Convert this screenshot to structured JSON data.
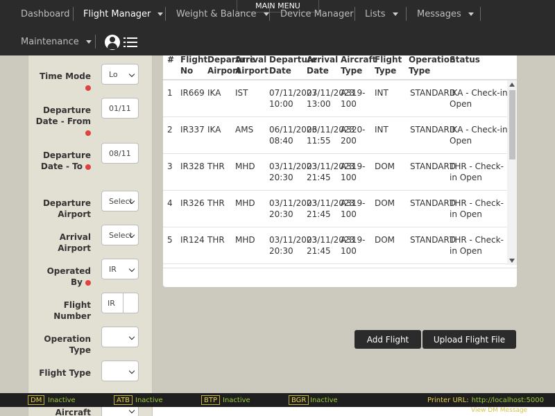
{
  "topbar": {
    "main_menu": "MAIN MENU",
    "nav": [
      {
        "label": "Dashboard",
        "dropdown": false,
        "active": false
      },
      {
        "label": "Flight Manager",
        "dropdown": true,
        "active": true
      },
      {
        "label": "Weight & Balance",
        "dropdown": true,
        "active": false
      },
      {
        "label": "Device Manager",
        "dropdown": false,
        "active": false
      },
      {
        "label": "Lists",
        "dropdown": true,
        "active": false
      },
      {
        "label": "Messages",
        "dropdown": true,
        "active": false
      },
      {
        "label": "Maintenance",
        "dropdown": true,
        "active": false
      }
    ],
    "icons": [
      "user-icon",
      "list-icon"
    ]
  },
  "filters": {
    "time_mode": {
      "label": "Time Mode",
      "value": "Lo",
      "required": true
    },
    "departure_from": {
      "label": "Departure Date - From",
      "value": "01/11",
      "required": true
    },
    "departure_to": {
      "label": "Departure Date - To",
      "value": "08/11",
      "required": true
    },
    "departure_airport": {
      "label": "Departure Airport",
      "value": "Select"
    },
    "arrival_airport": {
      "label": "Arrival Airport",
      "value": "Select"
    },
    "operated_by": {
      "label": "Operated By",
      "value": "IR",
      "required": true
    },
    "flight_number": {
      "label": "Flight Number",
      "prefix": "IR",
      "value": ""
    },
    "operation_type": {
      "label": "Operation Type",
      "value": ""
    },
    "flight_type": {
      "label": "Flight Type",
      "value": ""
    },
    "aircraft_type": {
      "label": "Aircraft Type",
      "value": ""
    }
  },
  "table": {
    "columns": [
      "#",
      "Flight No",
      "Departure Airport",
      "Arrival Airport",
      "Departure Date",
      "Arrival Date",
      "Aircraft Type",
      "Flight Type",
      "Operation Type",
      "Status"
    ],
    "rows": [
      {
        "num": "1",
        "flight": "IR669",
        "dep": "IKA",
        "arr": "IST",
        "dep_date": "07/11/2023 10:00",
        "arr_date": "07/11/2023 13:00",
        "aircraft": "A319-100",
        "ftype": "INT",
        "optype": "STANDARD",
        "status": "IKA - Check-in Open"
      },
      {
        "num": "2",
        "flight": "IR337",
        "dep": "IKA",
        "arr": "AMS",
        "dep_date": "06/11/2023 08:40",
        "arr_date": "06/11/2023 11:55",
        "aircraft": "A320-200",
        "ftype": "INT",
        "optype": "STANDARD",
        "status": "IKA - Check-in Open"
      },
      {
        "num": "3",
        "flight": "IR328",
        "dep": "THR",
        "arr": "MHD",
        "dep_date": "03/11/2023 20:30",
        "arr_date": "03/11/2023 21:45",
        "aircraft": "A319-100",
        "ftype": "DOM",
        "optype": "STANDARD",
        "status": "THR - Check-in Open"
      },
      {
        "num": "4",
        "flight": "IR326",
        "dep": "THR",
        "arr": "MHD",
        "dep_date": "03/11/2023 20:30",
        "arr_date": "03/11/2023 21:45",
        "aircraft": "A319-100",
        "ftype": "DOM",
        "optype": "STANDARD",
        "status": "THR - Check-in Open"
      },
      {
        "num": "5",
        "flight": "IR124",
        "dep": "THR",
        "arr": "MHD",
        "dep_date": "03/11/2023 20:30",
        "arr_date": "03/11/2023 21:45",
        "aircraft": "A319-100",
        "ftype": "DOM",
        "optype": "STANDARD",
        "status": "THR - Check-in Open"
      }
    ]
  },
  "actions": {
    "add_flight": "Add Flight",
    "upload_flight_file": "Upload Flight File"
  },
  "status_bar": {
    "devices": [
      {
        "tag": "DM",
        "state": "Inactive"
      },
      {
        "tag": "ATB",
        "state": "Inactive"
      },
      {
        "tag": "BTP",
        "state": "Inactive"
      },
      {
        "tag": "BGR",
        "state": "Inactive"
      }
    ],
    "printer_label": "Printer URL:",
    "printer_url": "http://localhost:5000",
    "view_dm": "View DM Message"
  },
  "colors": {
    "topbar": "#2b2b2b",
    "required": "#e04040",
    "status_active": "#9ccc3b",
    "status_tag": "#e8d54a"
  }
}
